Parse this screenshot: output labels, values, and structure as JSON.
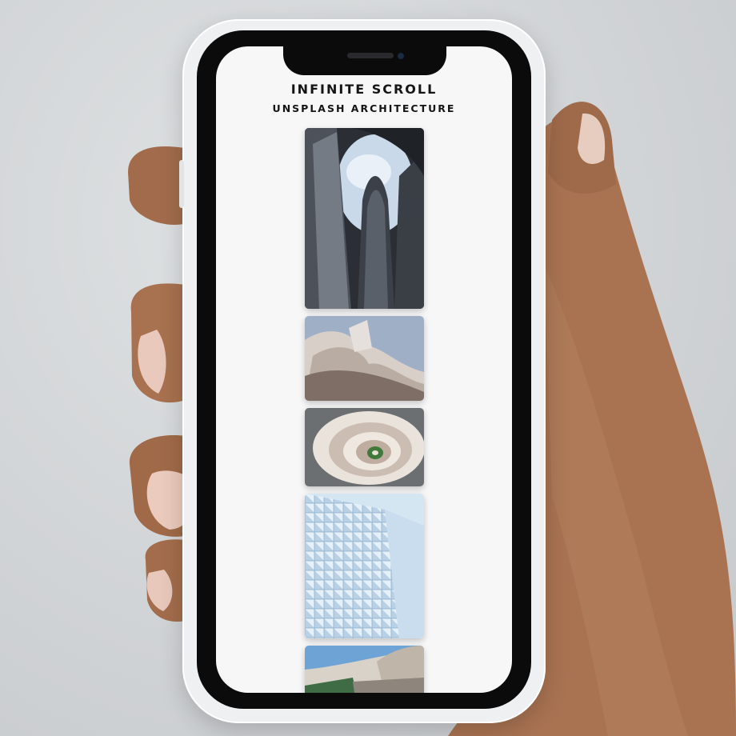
{
  "app": {
    "title": "INFINITE SCROLL",
    "subtitle": "UNSPLASH ARCHITECTURE"
  },
  "feed": {
    "items": [
      {
        "subject": "glass skyscrapers viewed from below"
      },
      {
        "subject": "curved metallic building facade"
      },
      {
        "subject": "white spiral staircase from above"
      },
      {
        "subject": "glass cube facade tower"
      },
      {
        "subject": "curved ribbed canopy building"
      }
    ]
  },
  "colors": {
    "screen_bg": "#f7f7f8",
    "text": "#151515",
    "phone_shell": "#eef0f1",
    "bezel": "#0b0b0c",
    "backdrop": "#d1d4d6"
  }
}
